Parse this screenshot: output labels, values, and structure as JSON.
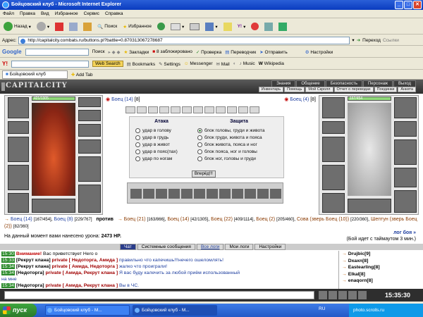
{
  "window": {
    "title": "Бойцовский клуб - Microsoft Internet Explorer"
  },
  "menu": [
    "Файл",
    "Правка",
    "Вид",
    "Избранное",
    "Сервис",
    "Справка"
  ],
  "toolbar": {
    "back": "Назад",
    "search": "Поиск",
    "favorites": "Избранное"
  },
  "address": {
    "label": "Адрес:",
    "url": "http://capitalcity.combats.ru/buttons.pl?battle=0.870313067278687",
    "go": "Переход",
    "links": "Ссылки"
  },
  "google": {
    "brand": "Google",
    "search": "Поиск",
    "bookmarks": "Закладки",
    "blocked": "8 заблокировано",
    "check": "Проверка",
    "translate": "Переводчик",
    "send": "Отправить",
    "settings": "Настройки"
  },
  "yahoo": {
    "brand": "Y!",
    "web_search": "Web Search",
    "bookmarks": "Bookmarks",
    "settings": "Settings",
    "messenger": "Messenger",
    "mail": "Mail",
    "music": "Music",
    "wikipedia": "Wikipedia"
  },
  "tab": {
    "label": "Бойцовский клуб",
    "add": "Add Tab"
  },
  "game": {
    "logo": "CAPITALCITY",
    "nav_top": [
      "Знания",
      "Общение",
      "Безопасность",
      "Персонаж",
      "Выход"
    ],
    "nav_bottom": [
      "Инвентарь",
      "Помощь",
      "Мой Скролл",
      "Отчет о переводах",
      "Поединки",
      "Анкета"
    ],
    "left_hp": "421/1305",
    "right_hp": "167/454",
    "left_fighter": "Боец (14)",
    "left_fighter_lvl": "[8]",
    "right_fighter": "Боец (4)",
    "right_fighter_lvl": "[8]",
    "attack_header": "Атака",
    "defense_header": "Защита",
    "attacks": [
      "удар в голову",
      "удар в грудь",
      "удар в живот",
      "удар в пояс(пах)",
      "удар по ногам"
    ],
    "defenses": [
      "блок головы, груди и живота",
      "блок груди, живота и пояса",
      "блок живота, пояса и ног",
      "блок пояса, ног и головы",
      "блок ног, головы и груди"
    ],
    "forward": "Вперёд!!!",
    "team1": [
      {
        "name": "Боец (14)",
        "hp": "[167/454]"
      },
      {
        "name": "Боец (8)",
        "hp": "[229/767]"
      }
    ],
    "versus": "против",
    "team2": [
      {
        "name": "Боец (21)",
        "hp": "[163/866]"
      },
      {
        "name": "Боец (14)",
        "hp": "[42/1305]"
      },
      {
        "name": "Боец (22)",
        "hp": "[409/1114]"
      },
      {
        "name": "Боец (2)",
        "hp": "[205/460]"
      }
    ],
    "team2_line2": [
      {
        "name": "Сова (зверь Боец (10))",
        "hp": "[220/360]"
      },
      {
        "name": "Шептун (зверь Боец (2))",
        "hp": "[82/360]"
      }
    ],
    "damage_label": "На данный момент вами нанесено урона:",
    "damage_value": "2473 HP.",
    "log": "лог боя »",
    "timeout": "(Бой идет с таймаутом 3 мин.)"
  },
  "chat": {
    "tabs": [
      "Чат",
      "Системные сообщения",
      "Все логи",
      "Мои логи",
      "Настройки"
    ],
    "lines": [
      {
        "time": "15:30",
        "who": "Внимание!",
        "text": " Вас приветствует Hero o"
      },
      {
        "time": "15:33",
        "who": "[Рекрут клана]",
        "priv": "private [ Недоторга, Амида ]",
        "text": "правильно что капечишь!!!нечего ошеломлять!"
      },
      {
        "time": "15:34",
        "who": "[Рекрут клана]",
        "priv": "private [ Амида, Недоторга ]",
        "text": "жалко что проиграли!"
      },
      {
        "time": "15:34",
        "who": "[Недоторга]",
        "priv": "private [ Амида, Рекрут клана ]",
        "text": "Я вас буду калечить за любой приём использованный"
      },
      {
        "time": "",
        "who": "",
        "priv": "",
        "text": "на мне"
      },
      {
        "time": "15:34",
        "who": "[Недоторга]",
        "priv": "private [ Амида, Рекрут клана ]",
        "text": "Вы в ЧС."
      }
    ]
  },
  "users": [
    "Drujbic[9]",
    "Dxaxn[8]",
    "Eastearling[8]",
    "Elkal[8]",
    "enaqorn[8]"
  ],
  "clock": "15:35:30",
  "taskbar": {
    "start": "пуск",
    "btn1": "Бойцовский клуб - М...",
    "btn2": "Бойцовский клуб - М...",
    "lang": "RU",
    "watermark": "photo.scrolls.ru"
  }
}
